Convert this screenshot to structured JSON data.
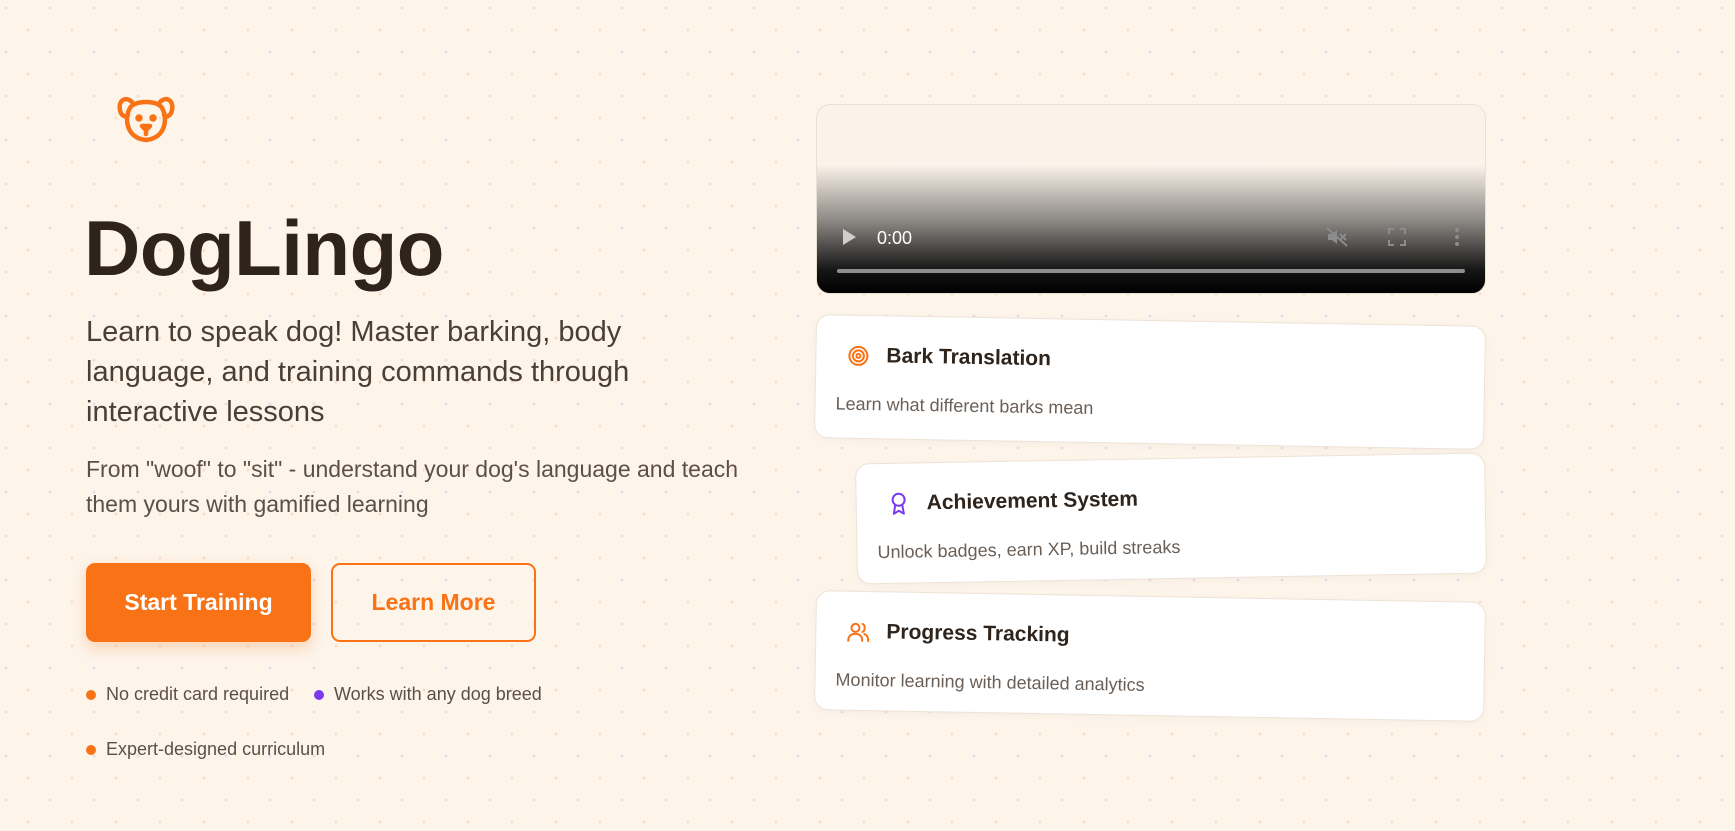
{
  "brand": {
    "logo_icon": "dog-face-icon",
    "title": "DogLingo",
    "accent": "#f97316",
    "secondary": "#7c3aed"
  },
  "hero": {
    "subtitle": "Learn to speak dog! Master barking, body language, and training commands through interactive lessons",
    "description": "From \"woof\" to \"sit\" - understand your dog's language and teach them yours with gamified learning",
    "primary_button": "Start Training",
    "secondary_button": "Learn More",
    "features": [
      {
        "label": "No credit card required",
        "color": "#f97316"
      },
      {
        "label": "Works with any dog breed",
        "color": "#7c3aed"
      },
      {
        "label": "Expert-designed curriculum",
        "color": "#f97316"
      }
    ]
  },
  "video": {
    "time": "0:00",
    "progress": 0
  },
  "cards": [
    {
      "icon": "target-icon",
      "title": "Bark Translation",
      "text": "Learn what different barks mean"
    },
    {
      "icon": "award-icon",
      "title": "Achievement System",
      "text": "Unlock badges, earn XP, build streaks"
    },
    {
      "icon": "users-icon",
      "title": "Progress Tracking",
      "text": "Monitor learning with detailed analytics"
    }
  ]
}
